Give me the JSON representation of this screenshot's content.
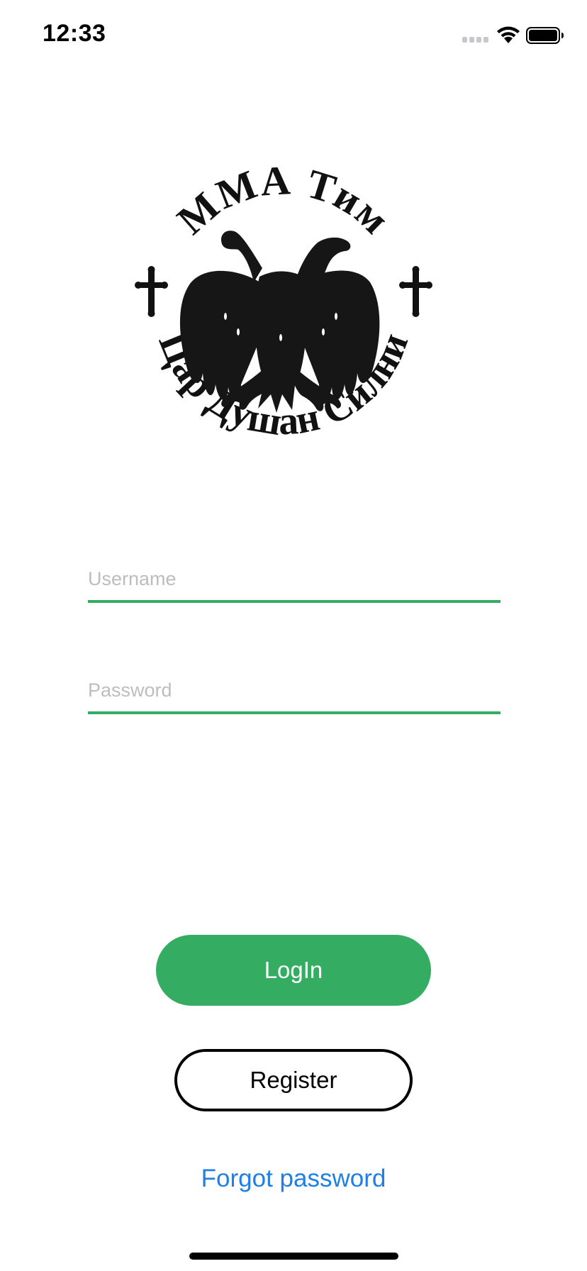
{
  "status_bar": {
    "time": "12:33",
    "icons": [
      "cellular-signal-icon",
      "wifi-icon",
      "battery-icon"
    ]
  },
  "logo": {
    "top_text": "ММА Тим",
    "bottom_text": "Цар Душан Силни",
    "icon": "double-headed-eagle-icon"
  },
  "form": {
    "username_placeholder": "Username",
    "username_value": "",
    "password_placeholder": "Password",
    "password_value": ""
  },
  "buttons": {
    "login_label": "LogIn",
    "register_label": "Register"
  },
  "links": {
    "forgot_password": "Forgot password"
  },
  "colors": {
    "accent": "#34ad63",
    "link": "#1e7fe6"
  }
}
